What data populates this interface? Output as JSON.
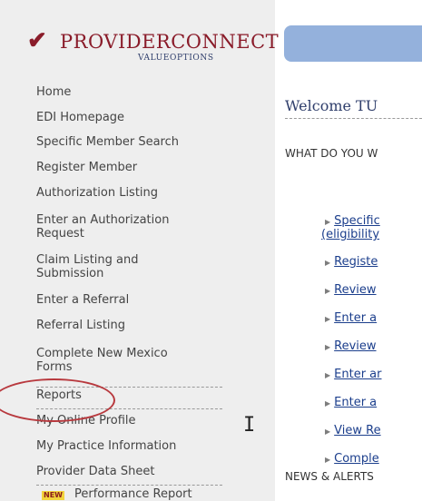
{
  "logo": {
    "mark": "✔",
    "name": "PROVIDERCONNECT",
    "sub": "VALUEOPTIONS"
  },
  "sidebar": {
    "items": [
      {
        "label": "Home"
      },
      {
        "label": "EDI Homepage"
      },
      {
        "label": "Specific Member Search"
      },
      {
        "label": "Register Member"
      },
      {
        "label": "Authorization Listing"
      },
      {
        "label": "Enter an Authorization Request"
      },
      {
        "label": "Claim Listing and Submission"
      },
      {
        "label": "Enter a Referral"
      },
      {
        "label": "Referral Listing"
      },
      {
        "label": "Complete New Mexico Forms"
      },
      {
        "label": "Reports"
      },
      {
        "label": "My Online Profile"
      },
      {
        "label": "My Practice Information"
      },
      {
        "label": "Provider Data Sheet"
      }
    ],
    "new_badge": "NEW",
    "performance_report": "Performance Report"
  },
  "main": {
    "welcome": "Welcome TU",
    "question": "WHAT DO YOU W",
    "links": [
      {
        "line1": "Specific",
        "line2": "(eligibility"
      },
      {
        "label": "Registe"
      },
      {
        "label": "Review"
      },
      {
        "label": "Enter a"
      },
      {
        "label": "Review"
      },
      {
        "label": "Enter ar"
      },
      {
        "label": "Enter a"
      },
      {
        "label": "View Re"
      },
      {
        "label": "Comple"
      }
    ],
    "news": "NEWS & ALERTS"
  },
  "colors": {
    "brand_red": "#8a1c2a",
    "brand_blue": "#2f3e6b",
    "header_band": "#94b1dc",
    "link": "#1b3e8c",
    "annotation_circle": "#b8393e"
  }
}
